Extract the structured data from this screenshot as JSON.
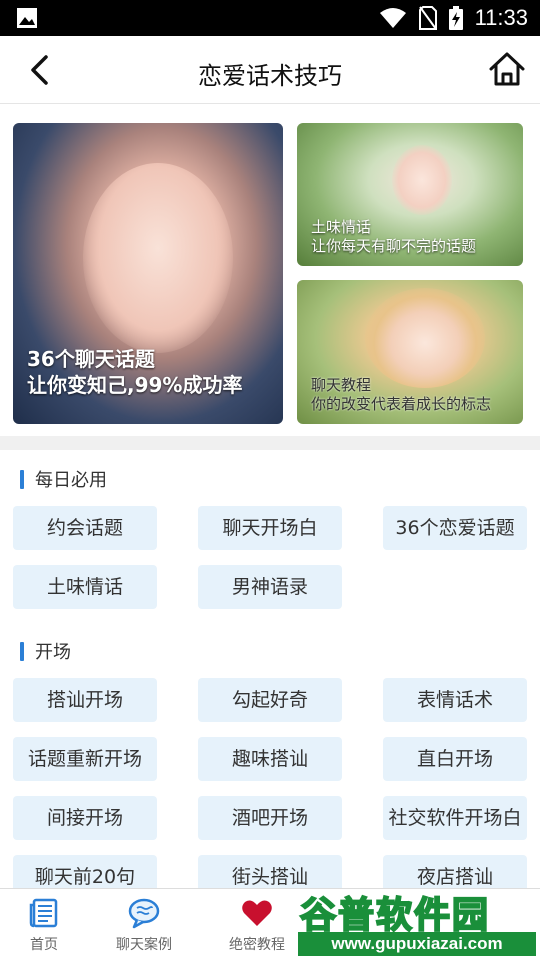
{
  "status_bar": {
    "time": "11:33"
  },
  "header": {
    "title": "恋爱话术技巧"
  },
  "banners": [
    {
      "line1": "36个聊天话题",
      "line2": "让你变知己,99%成功率"
    },
    {
      "line1": "土味情话",
      "line2": "让你每天有聊不完的话题"
    },
    {
      "line1": "聊天教程",
      "line2": "你的改变代表着成长的标志"
    }
  ],
  "sections": [
    {
      "title": "每日必用",
      "items": [
        "约会话题",
        "聊天开场白",
        "36个恋爱话题",
        "土味情话",
        "男神语录"
      ]
    },
    {
      "title": "开场",
      "items": [
        "搭讪开场",
        "勾起好奇",
        "表情话术",
        "话题重新开场",
        "趣味搭讪",
        "直白开场",
        "间接开场",
        "酒吧开场",
        "社交软件开场白",
        "聊天前20句",
        "街头搭讪",
        "夜店搭讪"
      ]
    }
  ],
  "bottom_nav": [
    {
      "label": "首页",
      "icon": "newspaper-icon"
    },
    {
      "label": "聊天案例",
      "icon": "chat-bubble-icon"
    },
    {
      "label": "绝密教程",
      "icon": "heart-icon"
    }
  ],
  "watermark": {
    "title": "谷普软件园",
    "url": "www.gupuxiazai.com"
  },
  "colors": {
    "accent": "#2b7fd6",
    "tag_bg": "#e6f2fb",
    "heart": "#c8102e",
    "watermark": "#1a8f3a"
  }
}
